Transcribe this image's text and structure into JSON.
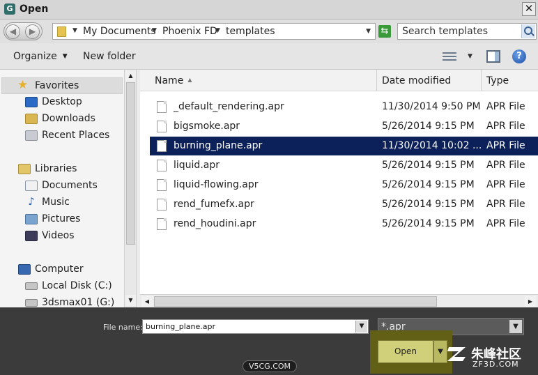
{
  "window": {
    "title": "Open",
    "app_icon_glyph": "G",
    "close_glyph": "✕"
  },
  "address": {
    "crumbs": [
      "My Documents",
      "Phoenix FD",
      "templates"
    ],
    "search_placeholder": "Search templates"
  },
  "toolbar": {
    "organize_label": "Organize",
    "new_folder_label": "New folder",
    "help_glyph": "?"
  },
  "nav": {
    "favorites": "Favorites",
    "desktop": "Desktop",
    "downloads": "Downloads",
    "recent_places": "Recent Places",
    "libraries": "Libraries",
    "documents": "Documents",
    "music": "Music",
    "pictures": "Pictures",
    "videos": "Videos",
    "computer": "Computer",
    "local_disk": "Local Disk (C:)",
    "network_drive": "3dsmax01 (G:)"
  },
  "columns": {
    "name": "Name",
    "date_modified": "Date modified",
    "type": "Type"
  },
  "files": [
    {
      "name": "_default_rendering.apr",
      "date": "11/30/2014 9:50 PM",
      "type": "APR File"
    },
    {
      "name": "bigsmoke.apr",
      "date": "5/26/2014 9:15 PM",
      "type": "APR File"
    },
    {
      "name": "burning_plane.apr",
      "date": "11/30/2014 10:02 ...",
      "type": "APR File",
      "selected": true
    },
    {
      "name": "liquid.apr",
      "date": "5/26/2014 9:15 PM",
      "type": "APR File"
    },
    {
      "name": "liquid-flowing.apr",
      "date": "5/26/2014 9:15 PM",
      "type": "APR File"
    },
    {
      "name": "rend_fumefx.apr",
      "date": "5/26/2014 9:15 PM",
      "type": "APR File"
    },
    {
      "name": "rend_houdini.apr",
      "date": "5/26/2014 9:15 PM",
      "type": "APR File"
    }
  ],
  "footer": {
    "file_name_label": "File name:",
    "file_name_value": "burning_plane.apr",
    "file_type_value": "*.apr",
    "open_label": "Open"
  },
  "watermarks": {
    "v5cg": "V5CG.COM",
    "zf3d_cn": "朱峰社区",
    "zf3d_url": "ZF3D.COM"
  },
  "colors": {
    "selection": "#0c2159",
    "open_button": "#d0d07a",
    "highlight_box": "#626016"
  }
}
